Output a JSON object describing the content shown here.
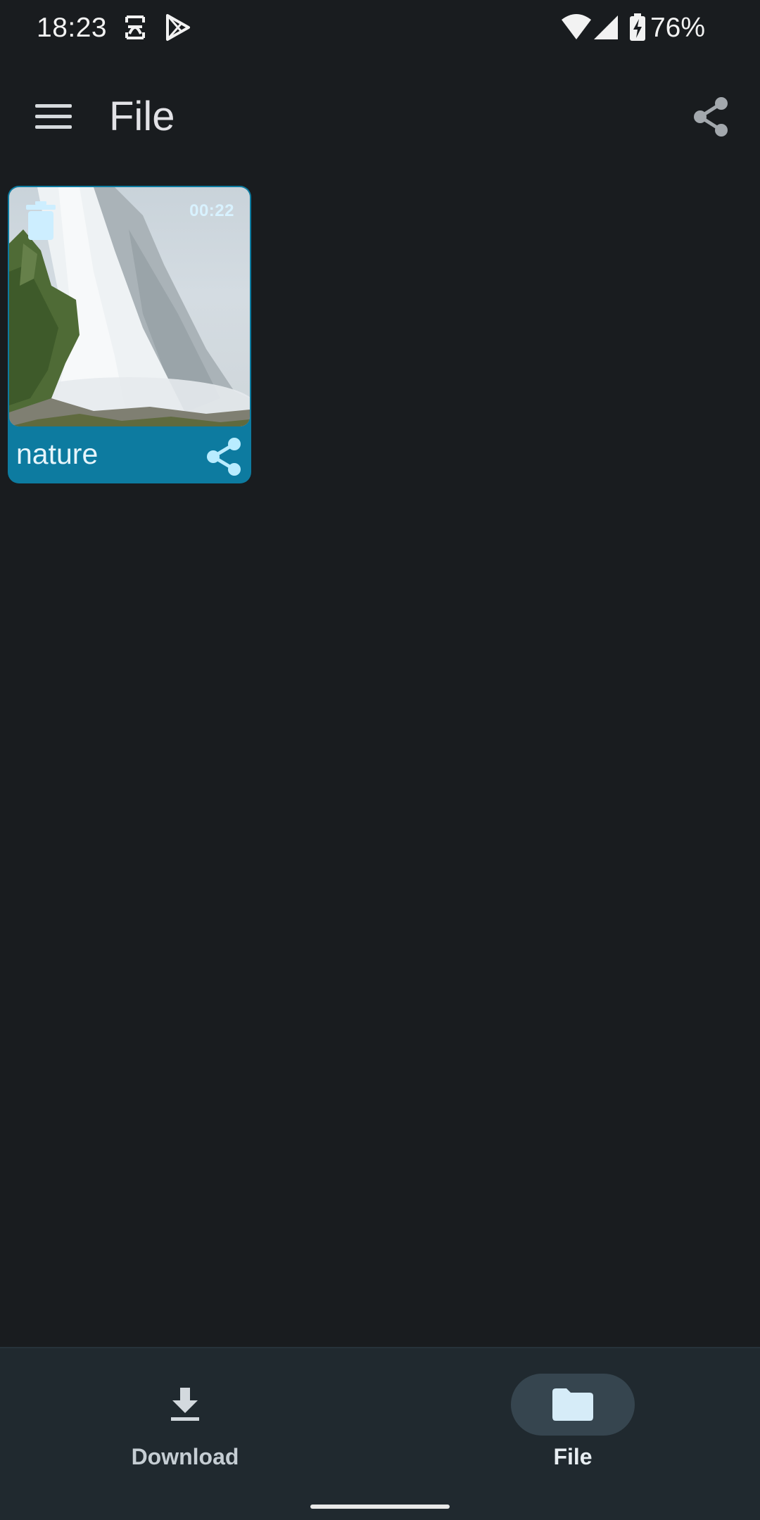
{
  "status_bar": {
    "time": "18:23",
    "battery": "76%",
    "icons": [
      "app-notification-icon",
      "play-store-icon",
      "wifi-icon",
      "cell-signal-icon",
      "battery-charging-icon"
    ]
  },
  "app_bar": {
    "title": "File",
    "menu_icon": "hamburger-menu-icon",
    "share_icon": "share-icon"
  },
  "files": [
    {
      "name": "nature",
      "duration": "00:22",
      "thumbnail": "waterfall-video-thumbnail"
    }
  ],
  "bottom_nav": {
    "items": [
      {
        "label": "Download",
        "icon": "download-icon",
        "selected": false
      },
      {
        "label": "File",
        "icon": "folder-icon",
        "selected": true
      }
    ]
  },
  "colors": {
    "background": "#191c1f",
    "card": "#0d7ba0",
    "nav_background": "#20292f",
    "nav_selected_pill": "#36454f"
  }
}
